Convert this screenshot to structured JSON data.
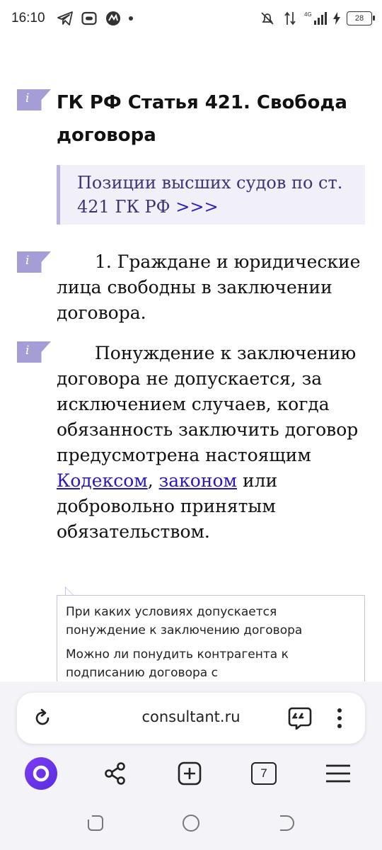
{
  "status_bar": {
    "time": "16:10",
    "network": "4G",
    "battery": "28",
    "left_icons": [
      "telegram-icon",
      "message-icon",
      "app-icon"
    ],
    "right_icons": [
      "mute-icon",
      "data-icon",
      "signal-icon",
      "charging-icon"
    ]
  },
  "article": {
    "marker_glyph": "i",
    "title": "ГК РФ Статья 421. Свобода договора",
    "positions_text": "Позиции высших судов по ст. 421 ГК РФ ",
    "positions_link": ">>>",
    "para1": "1. Граждане и юридические лица свободны в заключении договора.",
    "para2_before": "Понуждение к заключению договора не допускается, за исключением случаев, когда обязанность заключить договор предусмотрена настоящим ",
    "link_code": "Кодексом",
    "sep": ", ",
    "link_law": "законом",
    "para2_after": " или добровольно принятым обязательством."
  },
  "related_questions": [
    "При каких условиях допускается понуждение к заключению договора",
    "Можно ли понудить контрагента к подписанию договора с"
  ],
  "browser": {
    "url": "consultant.ru",
    "tabs_count": "7"
  },
  "colors": {
    "marker": "#a59ed6",
    "link": "#2a1ab4",
    "positions_bg": "#f1f0f8",
    "alice": "#6a34ea"
  }
}
